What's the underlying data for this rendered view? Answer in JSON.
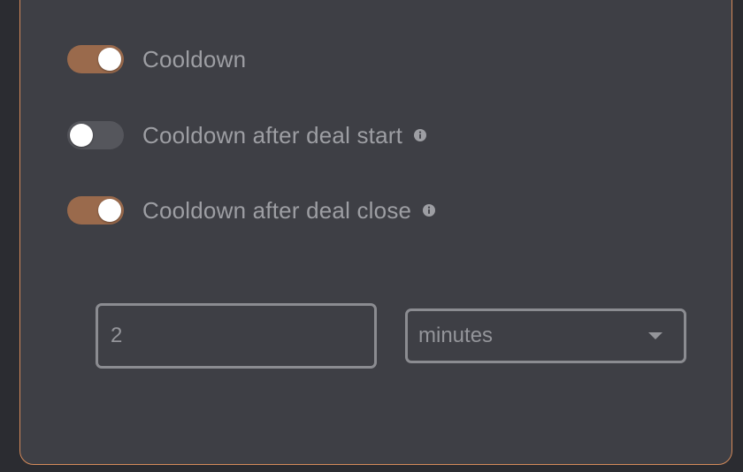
{
  "toggles": [
    {
      "label": "Cooldown",
      "state": "on",
      "has_info": false
    },
    {
      "label": "Cooldown after deal start",
      "state": "off",
      "has_info": true
    },
    {
      "label": "Cooldown after deal close",
      "state": "on",
      "has_info": true
    }
  ],
  "cooldown_value": "2",
  "cooldown_unit": "minutes",
  "colors": {
    "accent": "#d48a5a",
    "toggle_on": "#9a6a4c",
    "toggle_off": "#55565c",
    "panel_bg": "#3e3f45"
  }
}
